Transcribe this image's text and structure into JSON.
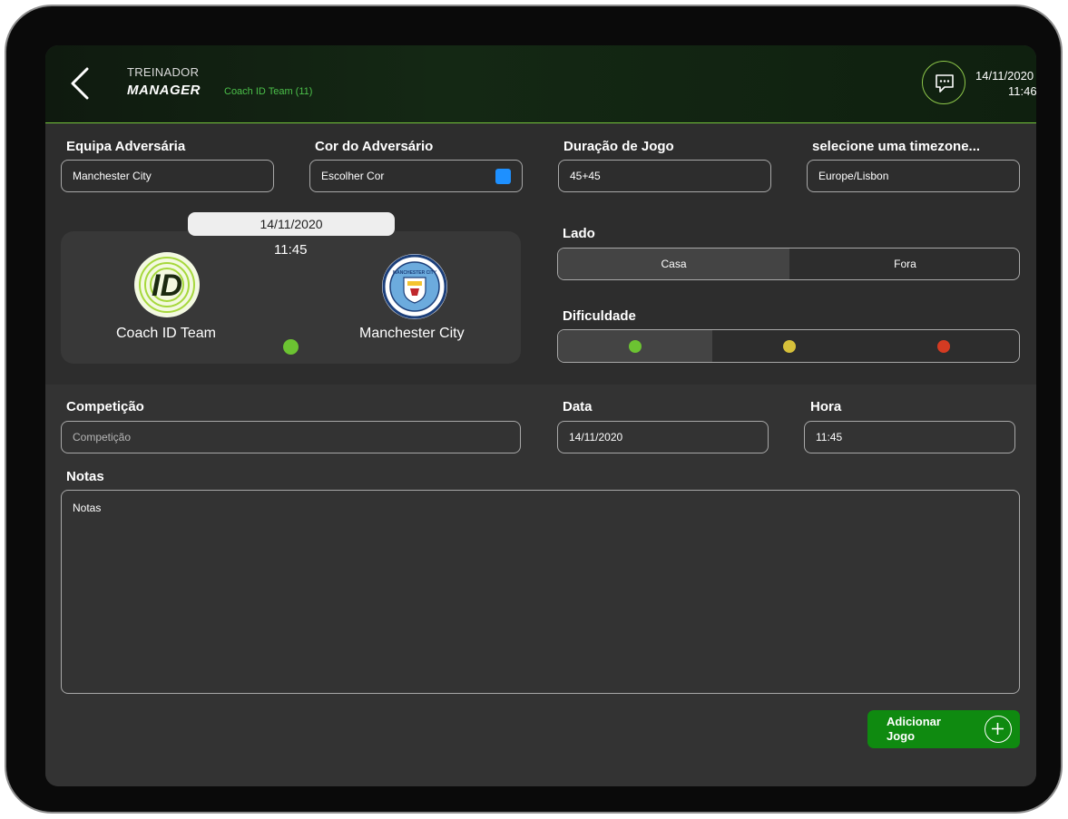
{
  "header": {
    "role": "TREINADOR",
    "title": "MANAGER",
    "team": "Coach ID Team (11)",
    "date": "14/11/2020",
    "time": "11:46",
    "chat_icon": "chat-bubble-icon",
    "back_icon": "chevron-left-icon"
  },
  "form": {
    "opponent": {
      "label": "Equipa Adversária",
      "value": "Manchester City"
    },
    "opponent_color": {
      "label": "Cor do Adversário",
      "value": "Escolher Cor",
      "color": "#1e90ff"
    },
    "duration": {
      "label": "Duração de Jogo",
      "value": "45+45"
    },
    "timezone": {
      "label": "selecione uma timezone...",
      "value": "Europe/Lisbon"
    },
    "side": {
      "label": "Lado",
      "options": [
        "Casa",
        "Fora"
      ],
      "selected": "Casa"
    },
    "difficulty": {
      "label": "Dificuldade",
      "levels": [
        {
          "color": "#6cc332"
        },
        {
          "color": "#d6c03a"
        },
        {
          "color": "#d43b22"
        }
      ],
      "selected_index": 0
    },
    "competition": {
      "label": "Competição",
      "placeholder": "Competição"
    },
    "date": {
      "label": "Data",
      "value": "14/11/2020"
    },
    "time": {
      "label": "Hora",
      "value": "11:45"
    },
    "notes": {
      "label": "Notas",
      "placeholder": "Notas"
    },
    "submit_label": "Adicionar Jogo"
  },
  "match_card": {
    "date": "14/11/2020",
    "time": "11:45",
    "home_team": "Coach ID Team",
    "home_logo_text": "ID",
    "away_team": "Manchester City",
    "away_logo_text": "MANCHESTER CITY",
    "status_color": "#6cc332"
  },
  "colors": {
    "accent_green": "#74c43a",
    "button_green": "#0f8a10",
    "background": "#2d2d2d"
  }
}
